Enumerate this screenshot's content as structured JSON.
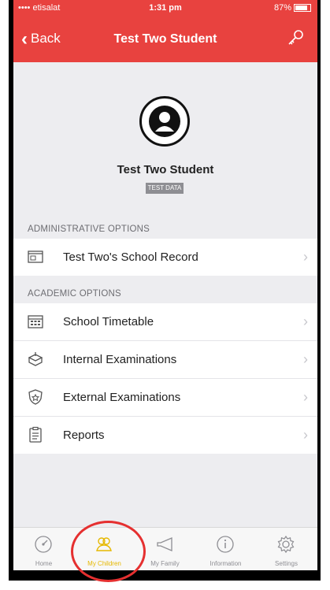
{
  "status": {
    "carrier": "•••• etisalat",
    "time": "1:31 pm",
    "battery": "87%"
  },
  "nav": {
    "back_label": "Back",
    "title": "Test Two Student"
  },
  "profile": {
    "name": "Test Two Student",
    "badge": "TEST DATA"
  },
  "sections": {
    "administrative": "ADMINISTRATIVE OPTIONS",
    "academic": "ACADEMIC OPTIONS"
  },
  "admin_items": [
    {
      "label": "Test Two's School Record",
      "icon": "id-card-icon"
    }
  ],
  "academic_items": [
    {
      "label": "School Timetable",
      "icon": "calendar-icon"
    },
    {
      "label": "Internal Examinations",
      "icon": "exam-box-icon"
    },
    {
      "label": "External Examinations",
      "icon": "badge-shield-icon"
    },
    {
      "label": "Reports",
      "icon": "clipboard-icon"
    }
  ],
  "tabs": [
    {
      "label": "Home",
      "icon": "gauge-icon"
    },
    {
      "label": "My Children",
      "icon": "children-icon"
    },
    {
      "label": "My Family",
      "icon": "megaphone-icon"
    },
    {
      "label": "Information",
      "icon": "info-icon"
    },
    {
      "label": "Settings",
      "icon": "gear-icon"
    }
  ],
  "colors": {
    "header": "#e8423f",
    "active_tab": "#e6b800",
    "annotation": "#e53030"
  }
}
